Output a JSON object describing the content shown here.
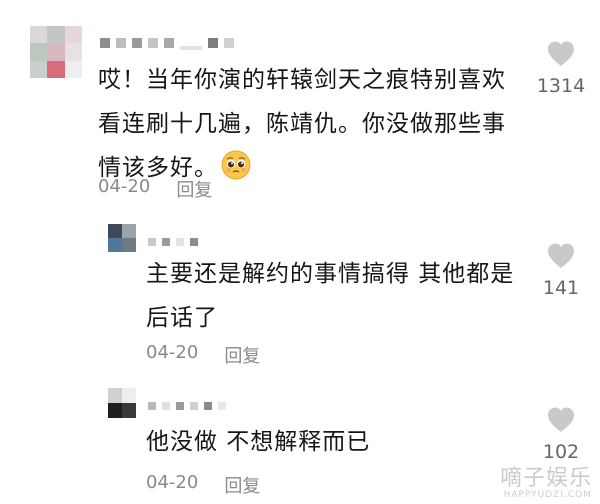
{
  "comments": [
    {
      "text": "哎！当年你演的轩辕剑天之痕特别喜欢看连刷十几遍，陈靖仇。你没做那些事情该多好。",
      "emoji": "pleading-face",
      "date": "04-20",
      "reply_label": "回复",
      "likes": "1314"
    },
    {
      "text": "主要还是解约的事情搞得  其他都是后话了",
      "date": "04-20",
      "reply_label": "回复",
      "likes": "141"
    },
    {
      "text": "他没做 不想解释而已",
      "date": "04-20",
      "reply_label": "回复",
      "likes": "102"
    }
  ],
  "watermark": {
    "main": "嘀子娱乐",
    "sub": "HAPPYUDZI.COM"
  },
  "colors": {
    "text": "#161616",
    "meta": "#8a8a8a",
    "heart": "#c9c9c9",
    "background": "#ffffff"
  }
}
